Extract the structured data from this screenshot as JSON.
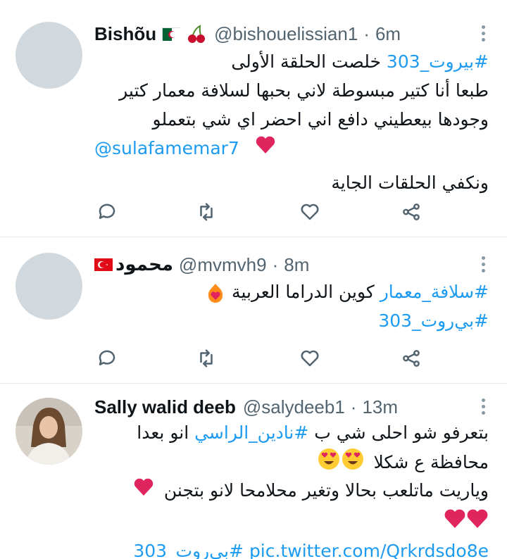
{
  "tweets": [
    {
      "name": "Bishõu",
      "handle": "@bishouelissian1",
      "dot": "·",
      "time": "6m",
      "lines": {
        "l1_tag": "#بيروت_303",
        "l1_text": "خلصت الحلقة الأولى",
        "l2": "طبعا أنا كتير مبسوطة لاني بحبها لسلافة معمار كتير",
        "l3": "وجودها بيعطيني دافع اني احضر اي شي بتعملو",
        "l4_mention": "@sulafamemar7",
        "l5": "ونكفي الحلقات الجاية"
      }
    },
    {
      "name": "محمود",
      "handle": "@mvmvh9",
      "dot": "·",
      "time": "8m",
      "lines": {
        "l1_tag": "#سلافة_معمار",
        "l1_text": "كوين الدراما العربية",
        "l2_tag": "#بي‌روت_303"
      }
    },
    {
      "name": "Sally walid deeb",
      "handle": "@salydeeb1",
      "dot": "·",
      "time": "13m",
      "lines": {
        "l1_text_a": "بتعرفو شو احلى شي ب",
        "l1_tag": "#نادين_الراسي",
        "l1_text_b": "انو بعدا",
        "l2": "محافظة ع شكلا",
        "l3": "وياريت ماتلعب بحالا وتغير محلامحا لانو بتجنن",
        "l5_tag": "#بي‌روت_303",
        "l5_link": "pic.twitter.com/Qrkrdsdo8e"
      }
    }
  ],
  "colors": {
    "link": "#1d9bf0",
    "secondary": "#536471",
    "heart": "#e0245e"
  },
  "icons": [
    "reply-icon",
    "retweet-icon",
    "like-icon",
    "share-icon",
    "more-icon",
    "algeria-flag-icon",
    "cherries-icon",
    "turkey-flag-icon",
    "fire-heart-emoji",
    "heart-eyes-emoji",
    "red-heart-emoji"
  ]
}
